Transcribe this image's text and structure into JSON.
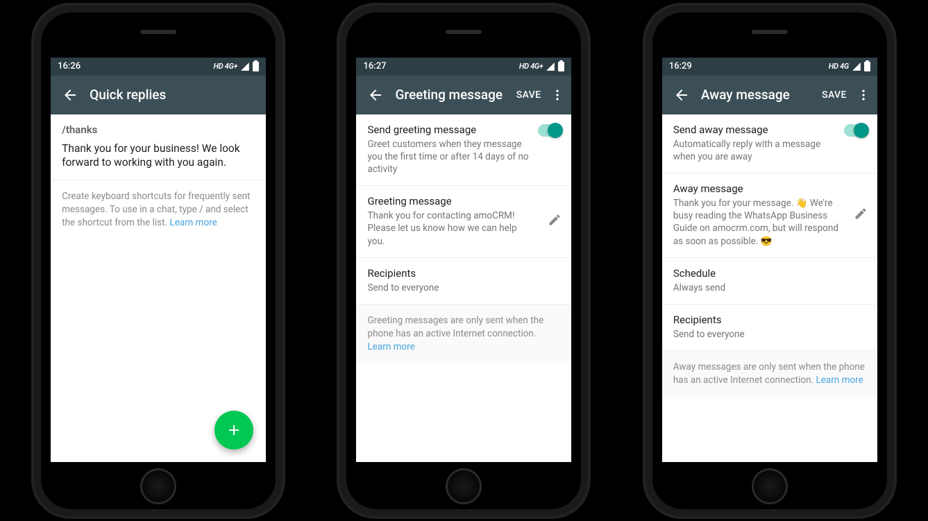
{
  "phones": [
    {
      "time": "16:26",
      "network": "HD 4G+",
      "title": "Quick replies",
      "save": null,
      "overflow": false,
      "shortcut": "/thanks",
      "shortcut_body": "Thank you for your business! We look forward to working with you again.",
      "footer": "Create keyboard shortcuts for frequently sent messages. To use in a chat, type / and select the shortcut from the list. ",
      "learn_more": "Learn more",
      "has_fab": true
    },
    {
      "time": "16:27",
      "network": "HD 4G+",
      "title": "Greeting message",
      "save": "SAVE",
      "overflow": true,
      "rows": [
        {
          "title": "Send greeting message",
          "sub": "Greet customers when they message you the first time or after 14 days of no activity",
          "toggle": true
        },
        {
          "title": "Greeting message",
          "sub": "Thank you for contacting amoCRM! Please let us know how we can help you.",
          "edit": true
        },
        {
          "title": "Recipients",
          "sub": "Send to everyone"
        }
      ],
      "footer": "Greeting messages are only sent when the phone has an active Internet connection. ",
      "learn_more": "Learn more"
    },
    {
      "time": "16:29",
      "network": "HD 4G",
      "title": "Away message",
      "save": "SAVE",
      "overflow": true,
      "rows": [
        {
          "title": "Send away message",
          "sub": "Automatically reply with a message when you are away",
          "toggle": true
        },
        {
          "title": "Away message",
          "sub": "Thank you for your message. 👋 We're busy reading the WhatsApp Business Guide on amocrm.com, but will respond as soon as possible. 😎",
          "edit": true
        },
        {
          "title": "Schedule",
          "sub": "Always send"
        },
        {
          "title": "Recipients",
          "sub": "Send to everyone"
        }
      ],
      "footer": "Away messages are only sent when the phone has an active Internet connection. ",
      "learn_more": "Learn more"
    }
  ]
}
